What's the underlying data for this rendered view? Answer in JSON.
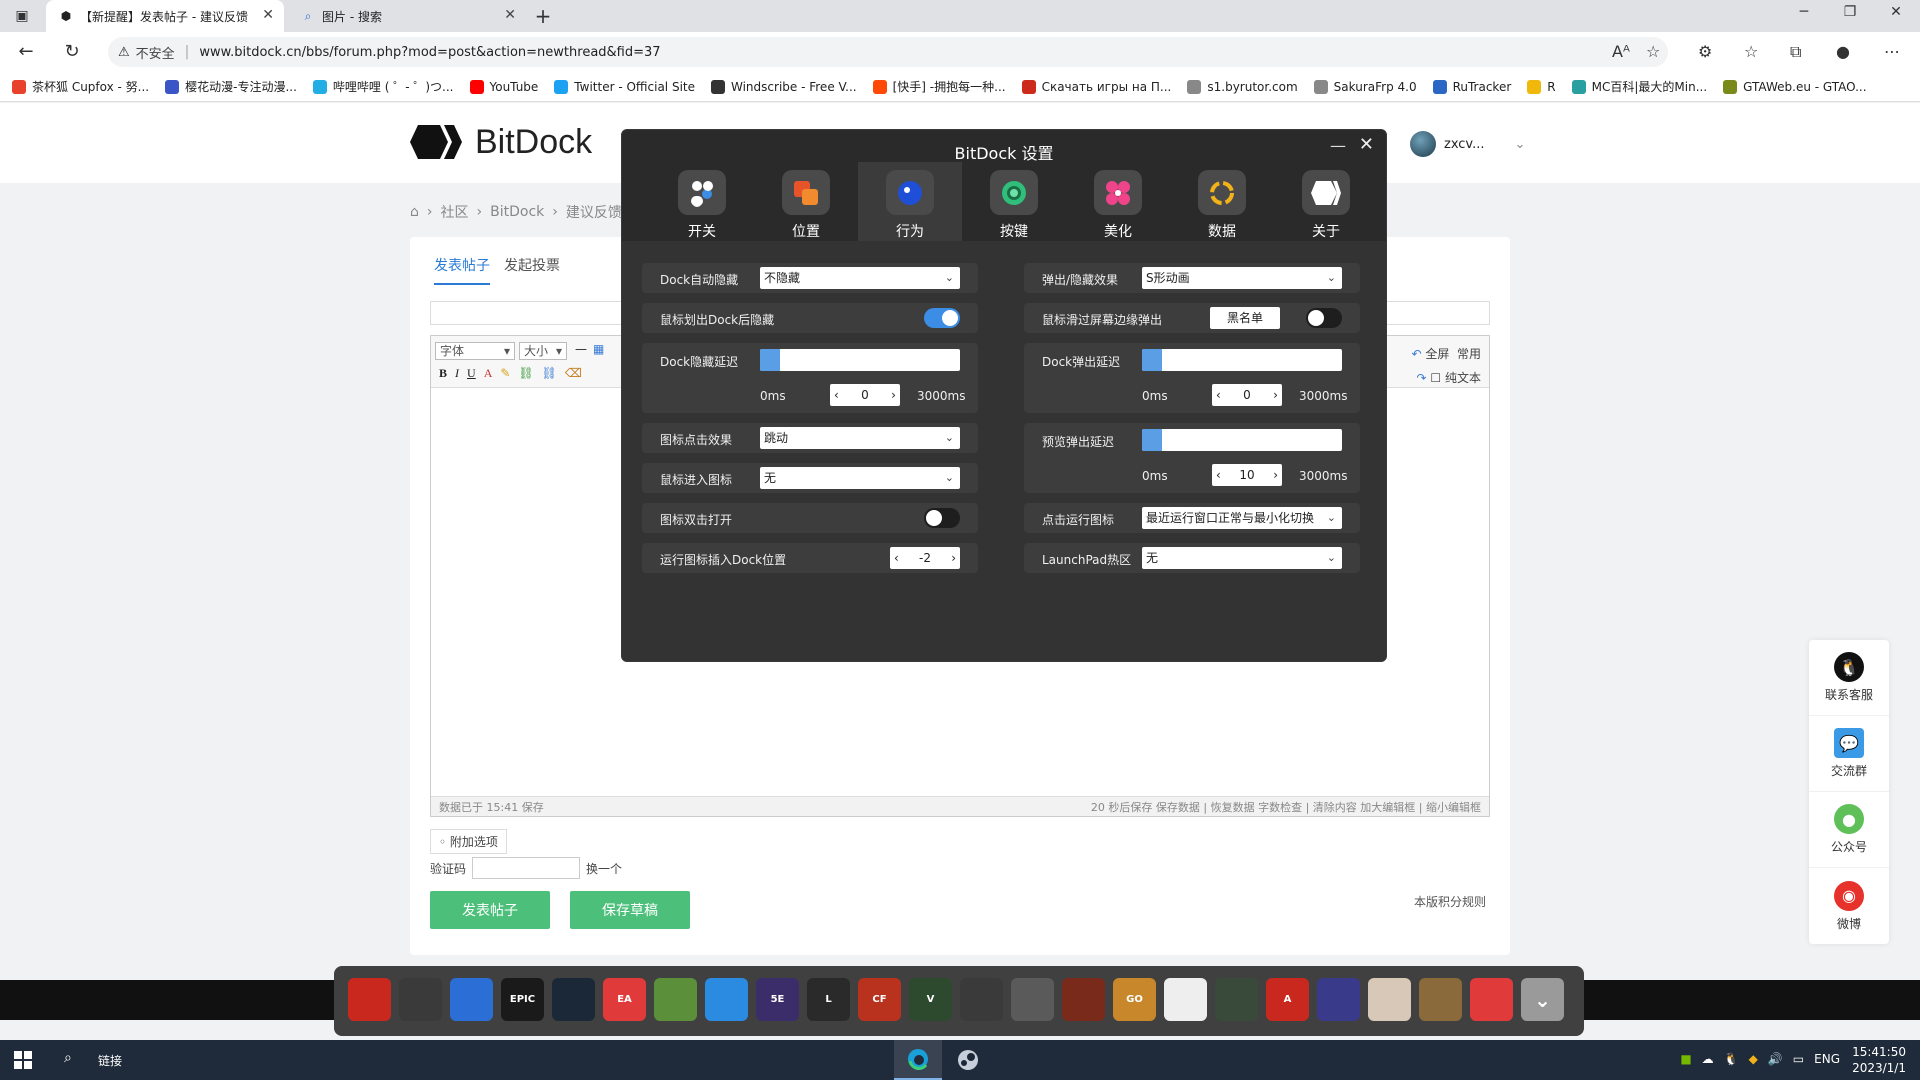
{
  "browser": {
    "tabs": [
      {
        "title": "【新提醒】发表帖子 - 建议反馈",
        "active": true,
        "icon": "bitdock-favicon"
      },
      {
        "title": "图片 - 搜索",
        "active": false,
        "icon": "search-favicon"
      }
    ],
    "security_label": "不安全",
    "url": "www.bitdock.cn/bbs/forum.php?mod=post&action=newthread&fid=37",
    "bookmarks": [
      {
        "label": "茶杯狐 Cupfox - 努...",
        "color": "#e8412c"
      },
      {
        "label": "樱花动漫-专注动漫...",
        "color": "#3a55c8"
      },
      {
        "label": "哔哩哔哩 ( ゜- ゜)つ...",
        "color": "#23ade5"
      },
      {
        "label": "YouTube",
        "color": "#ff0000"
      },
      {
        "label": "Twitter - Official Site",
        "color": "#1da1f2"
      },
      {
        "label": "Windscribe - Free V...",
        "color": "#333333"
      },
      {
        "label": "[快手] -拥抱每一种...",
        "color": "#ff4906"
      },
      {
        "label": "Скачать игры на П...",
        "color": "#cc2a1a"
      },
      {
        "label": "s1.byrutor.com",
        "color": "#888888"
      },
      {
        "label": "SakuraFrp 4.0",
        "color": "#888888"
      },
      {
        "label": "RuTracker",
        "color": "#2a66c4"
      },
      {
        "label": "R",
        "color": "#f1b80c"
      },
      {
        "label": "MC百科|最大的Min...",
        "color": "#2a9f9f"
      },
      {
        "label": "GTAWeb.eu - GTAO...",
        "color": "#7a8a1a"
      }
    ]
  },
  "site": {
    "logo_text": "BitDock",
    "username": "zxcv...",
    "breadcrumb": [
      "社区",
      "BitDock",
      "建议反馈"
    ],
    "post_tabs": [
      "发表帖子",
      "发起投票"
    ],
    "editor": {
      "font_select": "字体",
      "size_select": "大小",
      "fullscreen": "全屏",
      "common": "常用",
      "plain_text": "纯文本",
      "saved_status": "数据已于 15:41 保存",
      "status_right": "20 秒后保存 保存数据 | 恢复数据    字数检查 | 清除内容    加大编辑框 | 缩小编辑框"
    },
    "attach_label": "附加选项",
    "captcha_label": "验证码",
    "captcha_refresh": "换一个",
    "submit_label": "发表帖子",
    "draft_label": "保存草稿",
    "rules_label": "本版积分规则",
    "side_float": [
      "联系客服",
      "交流群",
      "公众号",
      "微博"
    ]
  },
  "bitdock": {
    "title": "BitDock 设置",
    "tabs": [
      {
        "label": "开关",
        "icon": "switch-icon",
        "active": false
      },
      {
        "label": "位置",
        "icon": "position-icon",
        "active": false
      },
      {
        "label": "行为",
        "icon": "behavior-icon",
        "active": true
      },
      {
        "label": "按键",
        "icon": "key-icon",
        "active": false
      },
      {
        "label": "美化",
        "icon": "beautify-icon",
        "active": false
      },
      {
        "label": "数据",
        "icon": "data-icon",
        "active": false
      },
      {
        "label": "关于",
        "icon": "about-icon",
        "active": false
      }
    ],
    "left": {
      "auto_hide_label": "Dock自动隐藏",
      "auto_hide_value": "不隐藏",
      "mouse_out_hide_label": "鼠标划出Dock后隐藏",
      "mouse_out_hide_on": true,
      "hide_delay_label": "Dock隐藏延迟",
      "hide_delay_value": "0",
      "hide_delay_min": "0ms",
      "hide_delay_max": "3000ms",
      "hide_delay_fraction": 0,
      "click_effect_label": "图标点击效果",
      "click_effect_value": "跳动",
      "mouse_enter_label": "鼠标进入图标",
      "mouse_enter_value": "无",
      "double_click_label": "图标双击打开",
      "double_click_on": false,
      "insert_pos_label": "运行图标插入Dock位置",
      "insert_pos_value": "-2"
    },
    "right": {
      "popup_effect_label": "弹出/隐藏效果",
      "popup_effect_value": "S形动画",
      "edge_popup_label": "鼠标滑过屏幕边缘弹出",
      "blacklist_label": "黑名单",
      "edge_popup_on": false,
      "popup_delay_label": "Dock弹出延迟",
      "popup_delay_value": "0",
      "popup_delay_min": "0ms",
      "popup_delay_max": "3000ms",
      "popup_delay_fraction": 0,
      "preview_delay_label": "预览弹出延迟",
      "preview_delay_value": "10",
      "preview_delay_min": "0ms",
      "preview_delay_max": "3000ms",
      "preview_delay_fraction": 0.003,
      "click_running_label": "点击运行图标",
      "click_running_value": "最近运行窗口正常与最小化切换",
      "launchpad_label": "LaunchPad热区",
      "launchpad_value": "无"
    }
  },
  "dock_apps": [
    {
      "name": "app-red-dragon",
      "color": "#c8281e",
      "text": ""
    },
    {
      "name": "app-orange",
      "color": "#3a3a3a",
      "text": ""
    },
    {
      "name": "app-battlenet",
      "color": "#2b6fd6",
      "text": ""
    },
    {
      "name": "app-epic",
      "color": "#1a1a1a",
      "text": "EPIC"
    },
    {
      "name": "app-steam",
      "color": "#1b2838",
      "text": ""
    },
    {
      "name": "app-ea",
      "color": "#e03a3a",
      "text": "EA"
    },
    {
      "name": "app-minecraft",
      "color": "#5c8f3a",
      "text": ""
    },
    {
      "name": "app-ubisoft",
      "color": "#2b8be0",
      "text": ""
    },
    {
      "name": "app-5e",
      "color": "#3a2d6a",
      "text": "5E"
    },
    {
      "name": "app-lol",
      "color": "#2a2a2a",
      "text": "L"
    },
    {
      "name": "app-crossfire",
      "color": "#b8321e",
      "text": "CF"
    },
    {
      "name": "app-gta5",
      "color": "#2e4a2e",
      "text": "V"
    },
    {
      "name": "app-overwatch",
      "color": "#3a3a3a",
      "text": ""
    },
    {
      "name": "app-pubg",
      "color": "#5a5a5a",
      "text": ""
    },
    {
      "name": "app-game-red",
      "color": "#7a2a1a",
      "text": ""
    },
    {
      "name": "app-csgo",
      "color": "#c7872a",
      "text": "GO"
    },
    {
      "name": "app-warframe",
      "color": "#eeeeee",
      "text": ""
    },
    {
      "name": "app-game-green",
      "color": "#3a4a3a",
      "text": ""
    },
    {
      "name": "app-apex",
      "color": "#c8281e",
      "text": "A"
    },
    {
      "name": "app-game-blue",
      "color": "#3a3a8a",
      "text": ""
    },
    {
      "name": "app-genshin",
      "color": "#d8c8b8",
      "text": ""
    },
    {
      "name": "app-crafting",
      "color": "#8a6a3a",
      "text": ""
    },
    {
      "name": "app-netease-music",
      "color": "#e03a3a",
      "text": ""
    },
    {
      "name": "app-more",
      "color": "#8a8a8a",
      "text": ""
    }
  ],
  "taskbar": {
    "link_label": "链接",
    "lang": "ENG",
    "time": "15:41:50",
    "date": "2023/1/1"
  }
}
